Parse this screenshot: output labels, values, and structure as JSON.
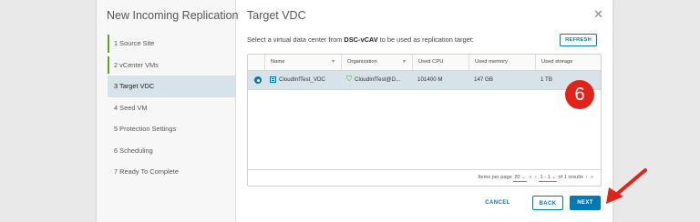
{
  "wizard": {
    "title": "New Incoming Replication",
    "steps": [
      {
        "label": "1 Source Site",
        "state": "done"
      },
      {
        "label": "2 vCenter VMs",
        "state": "done"
      },
      {
        "label": "3 Target VDC",
        "state": "active"
      },
      {
        "label": "4 Seed VM",
        "state": "pending"
      },
      {
        "label": "5 Protection Settings",
        "state": "pending"
      },
      {
        "label": "6 Scheduling",
        "state": "pending"
      },
      {
        "label": "7 Ready To Complete",
        "state": "pending"
      }
    ]
  },
  "page": {
    "title": "Target VDC",
    "instruction_prefix": "Select a virtual data center from ",
    "instruction_site": "DSC-vCAV",
    "instruction_suffix": " to be used as replication target:",
    "refresh_label": "REFRESH"
  },
  "table": {
    "columns": [
      "Name",
      "Organization",
      "Used CPU",
      "Used memory",
      "Used storage"
    ],
    "rows": [
      {
        "name": "CloudInfTest_VDC",
        "organization": "CloudInfTest@D...",
        "used_cpu": "101400 M",
        "used_memory": "147 GB",
        "used_storage": "1 TB",
        "selected": true
      }
    ],
    "footer": {
      "items_per_page_label": "Items per page",
      "page_size": "20",
      "range": "1 - 1",
      "total": "of 1 results"
    }
  },
  "buttons": {
    "cancel": "CANCEL",
    "back": "BACK",
    "next": "NEXT"
  },
  "annotation": {
    "badge": "6",
    "color": "#e2231a"
  },
  "colors": {
    "accent": "#0079b8",
    "done": "#62a420",
    "selected_row": "#d8e3e9"
  }
}
